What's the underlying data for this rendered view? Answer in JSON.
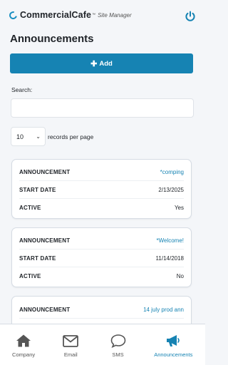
{
  "header": {
    "brand": "CommercialCafe",
    "brand_tm": "™",
    "sub_brand": "Site Manager"
  },
  "page": {
    "title": "Announcements",
    "add_label": "Add",
    "search_label": "Search:",
    "search_value": "",
    "per_page_value": "10",
    "records_label": "records per page"
  },
  "cards": [
    {
      "announcement_key": "ANNOUNCEMENT",
      "announcement_value": "*comping",
      "start_key": "START DATE",
      "start_value": "2/13/2025",
      "active_key": "ACTIVE",
      "active_value": "Yes"
    },
    {
      "announcement_key": "ANNOUNCEMENT",
      "announcement_value": "*Welcome!",
      "start_key": "START DATE",
      "start_value": "11/14/2018",
      "active_key": "ACTIVE",
      "active_value": "No"
    },
    {
      "announcement_key": "ANNOUNCEMENT",
      "announcement_value": "14 july prod ann"
    }
  ],
  "nav": {
    "items": [
      {
        "label": "Company",
        "icon": "home-icon"
      },
      {
        "label": "Email",
        "icon": "envelope-icon"
      },
      {
        "label": "SMS",
        "icon": "chat-bubble-icon"
      },
      {
        "label": "Announcements",
        "icon": "megaphone-icon"
      }
    ],
    "active_index": 3
  },
  "colors": {
    "accent": "#1683b3",
    "icon_gray": "#555555",
    "background": "#f4f6f9"
  }
}
